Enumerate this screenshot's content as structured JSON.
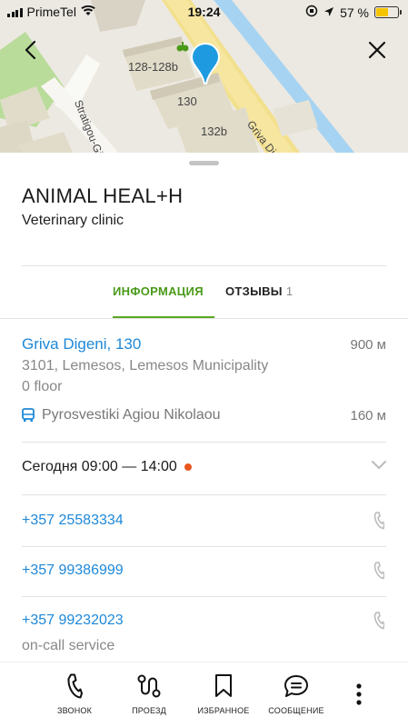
{
  "status": {
    "carrier": "PrimeTel",
    "time": "19:24",
    "battery_pct": "57 %",
    "battery_level": 0.57
  },
  "map": {
    "labels": [
      "128-128b",
      "130",
      "132b",
      "Griva Digeni",
      "Stratigou-Gi"
    ]
  },
  "place": {
    "title": "ANIMAL HEAL+H",
    "subtitle": "Veterinary clinic"
  },
  "tabs": {
    "info": "ИНФОРМАЦИЯ",
    "reviews": "ОТЗЫВЫ",
    "reviews_count": "1"
  },
  "address": {
    "street": "Griva Digeni, 130",
    "distance": "900 м",
    "line2": "3101, Lemesos, Lemesos Municipality",
    "floor": "0 floor"
  },
  "transit": {
    "stop": "Pyrosvestiki Agiou Nikolaou",
    "distance": "160 м"
  },
  "hours": {
    "text": "Сегодня 09:00 — 14:00",
    "status_color": "#e8561f"
  },
  "phones": [
    {
      "number": "+357 25583334"
    },
    {
      "number": "+357 99386999"
    },
    {
      "number": "+357 99232023",
      "note": "on-call service"
    }
  ],
  "toolbar": {
    "call": "ЗВОНОК",
    "route": "ПРОЕЗД",
    "favorite": "ИЗБРАННОЕ",
    "message": "СООБЩЕНИЕ"
  },
  "colors": {
    "accent": "#5aa821",
    "link": "#1e88d8",
    "pin": "#1e9be0"
  }
}
